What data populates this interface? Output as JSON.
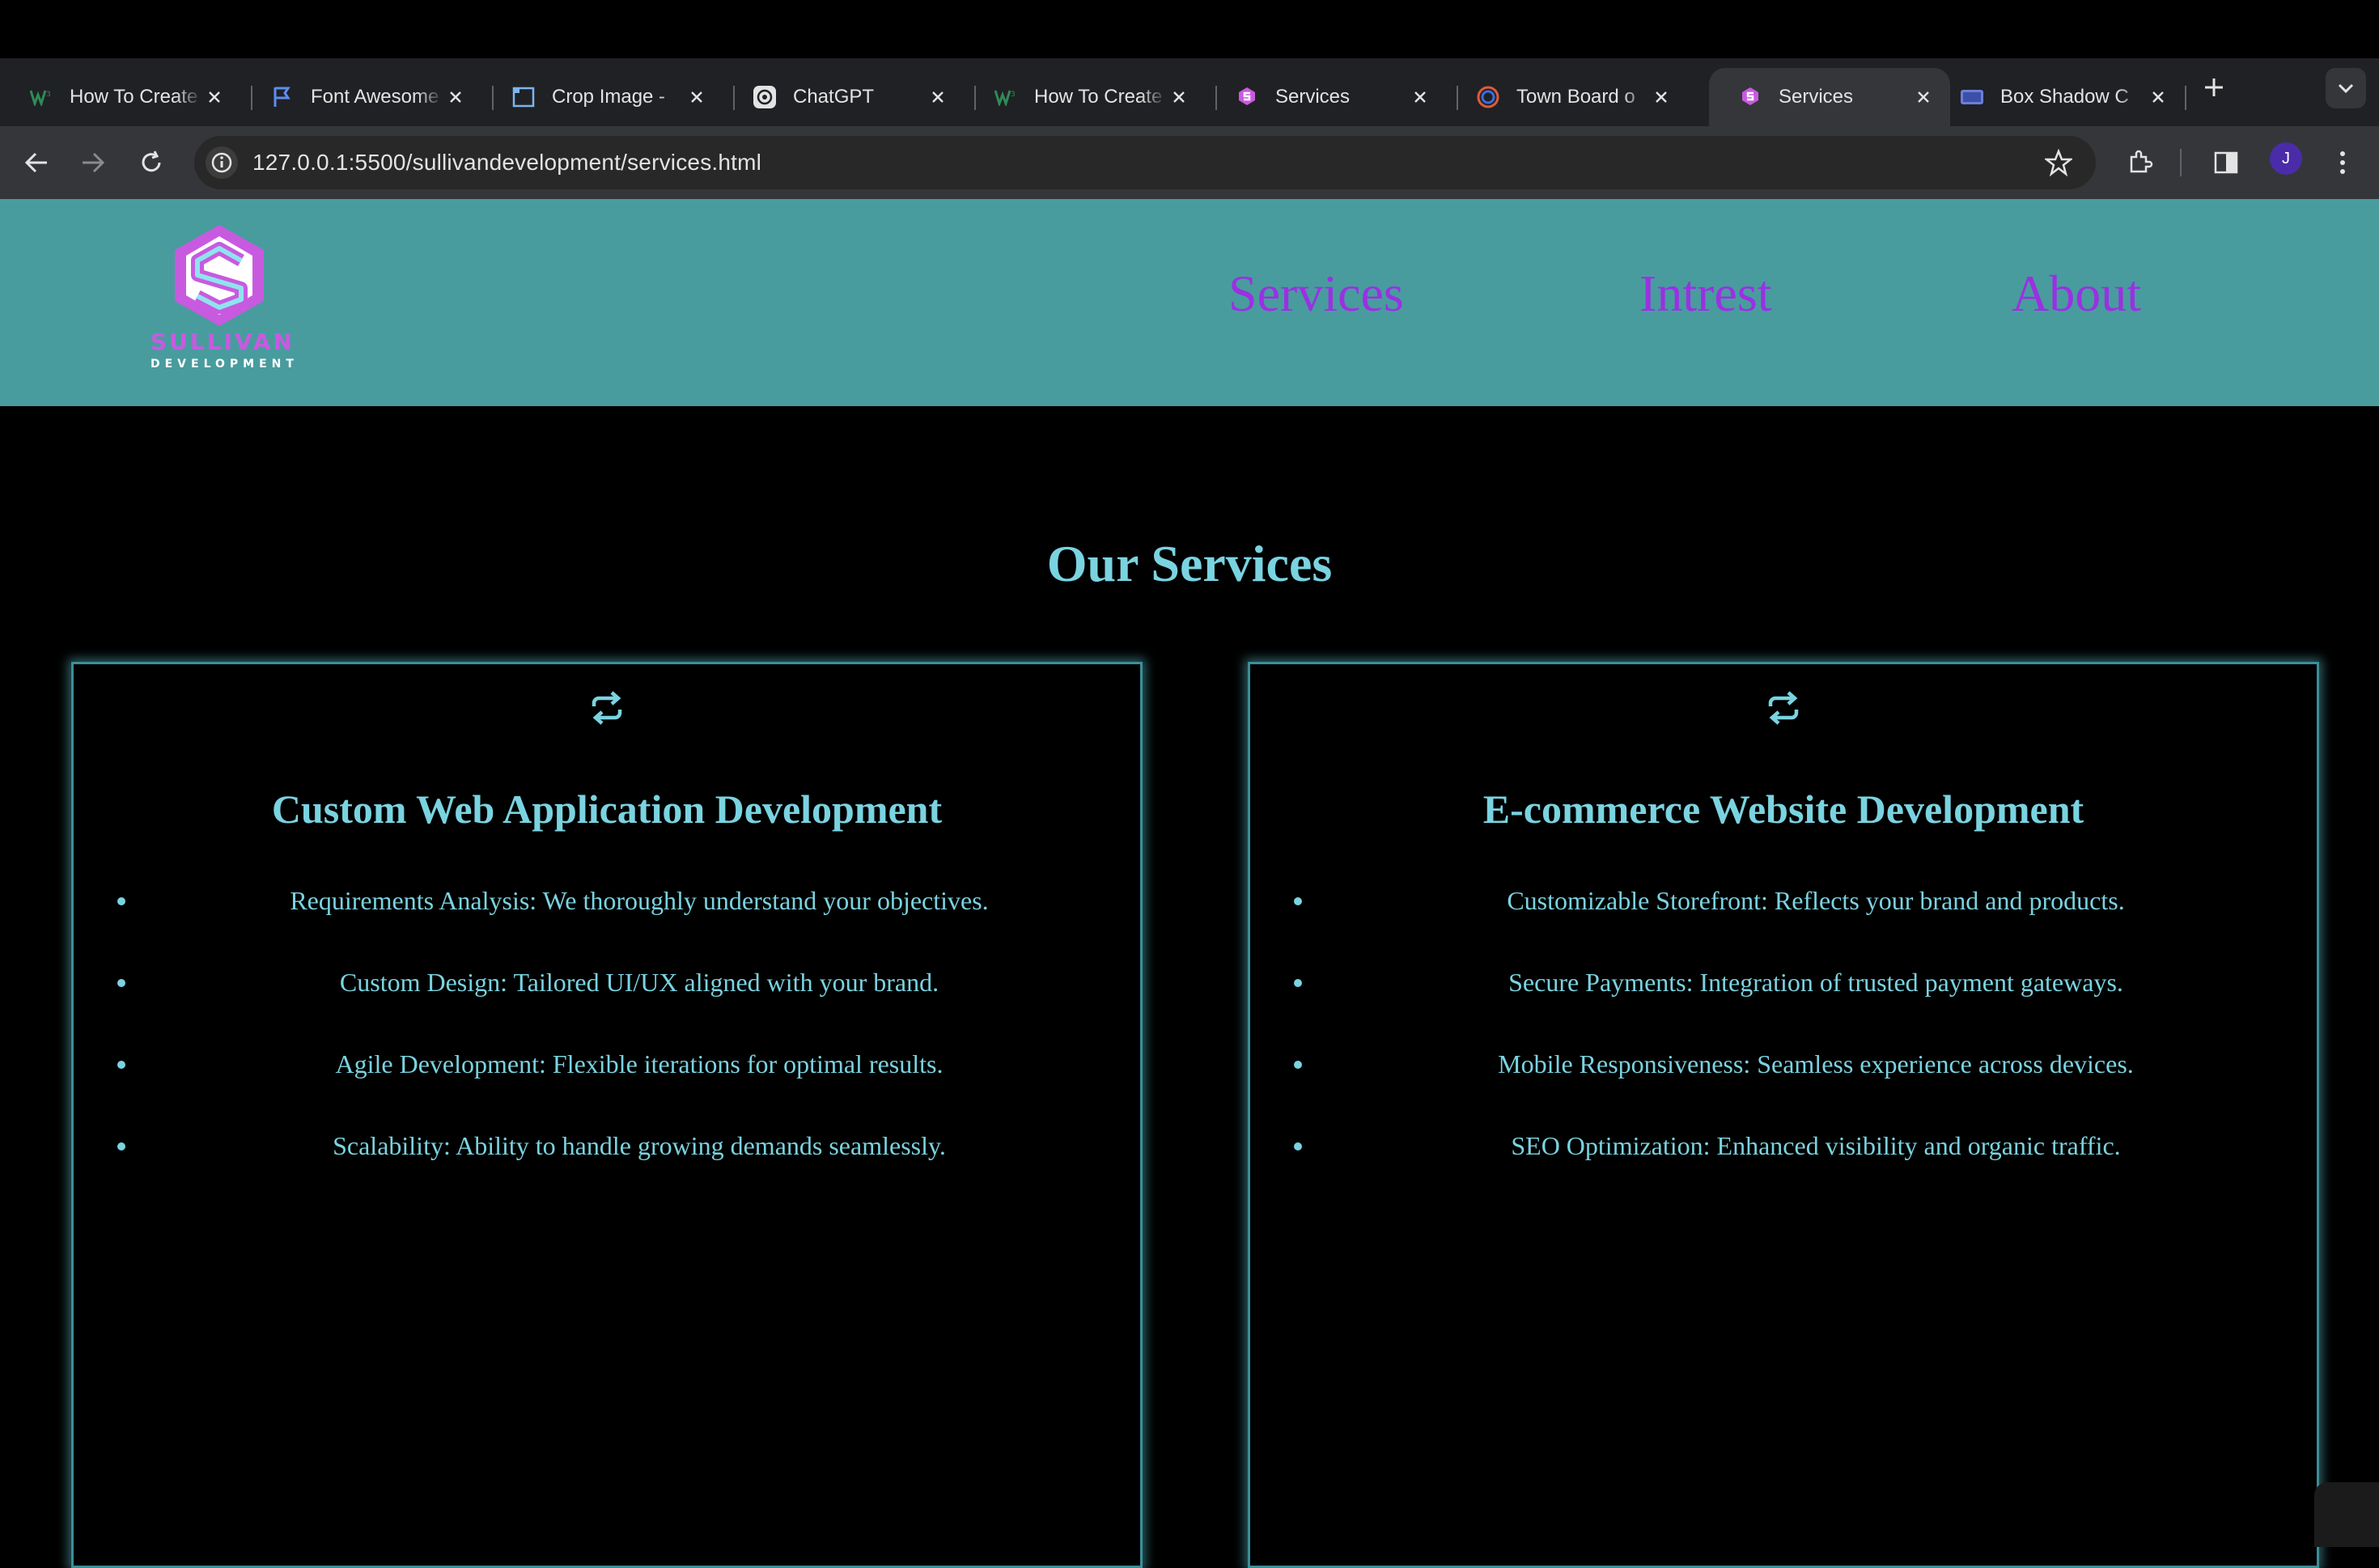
{
  "browser": {
    "tabs": [
      {
        "title": "How To Create",
        "favicon": "w-logo-icon"
      },
      {
        "title": "Font Awesome",
        "favicon": "flag-icon"
      },
      {
        "title": "Crop Image -",
        "favicon": "crop-icon"
      },
      {
        "title": "ChatGPT",
        "favicon": "chatgpt-icon"
      },
      {
        "title": "How To Create",
        "favicon": "w-logo-icon"
      },
      {
        "title": "Services",
        "favicon": "sullivan-favicon"
      },
      {
        "title": "Town Board o",
        "favicon": "town-board-icon"
      },
      {
        "title": "Services",
        "favicon": "sullivan-favicon",
        "active": true
      },
      {
        "title": "Box Shadow C",
        "favicon": "box-shadow-icon"
      }
    ],
    "url": "127.0.0.1:5500/sullivandevelopment/services.html",
    "profile_initial": "J"
  },
  "site": {
    "logo": {
      "word1": "SULLIVAN",
      "word2": "DEVELOPMENT"
    },
    "nav": [
      "Services",
      "Intrest",
      "About"
    ],
    "page_title": "Our Services",
    "cards": [
      {
        "icon": "sync-icon",
        "title": "Custom Web Application Development",
        "items": [
          "Requirements Analysis: We thoroughly understand your objectives.",
          "Custom Design: Tailored UI/UX aligned with your brand.",
          "Agile Development: Flexible iterations for optimal results.",
          "Scalability: Ability to handle growing demands seamlessly."
        ]
      },
      {
        "icon": "sync-icon",
        "title": "E-commerce Website Development",
        "items": [
          "Customizable Storefront: Reflects your brand and products.",
          "Secure Payments: Integration of trusted payment gateways.",
          "Mobile Responsiveness: Seamless experience across devices.",
          "SEO Optimization: Enhanced visibility and organic traffic."
        ]
      }
    ]
  },
  "colors": {
    "header_bg": "#489c9e",
    "nav_link": "#9b30e3",
    "accent_text": "#7ad3e0",
    "page_bg": "#000000"
  }
}
